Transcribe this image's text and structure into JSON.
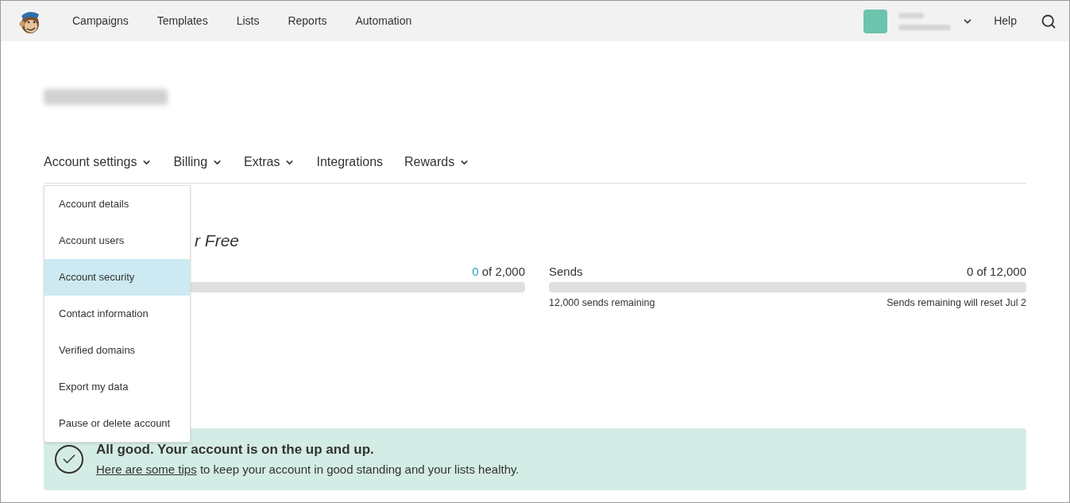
{
  "nav": {
    "items": [
      "Campaigns",
      "Templates",
      "Lists",
      "Reports",
      "Automation"
    ],
    "help": "Help"
  },
  "subnav": [
    {
      "label": "Account settings",
      "has_menu": true
    },
    {
      "label": "Billing",
      "has_menu": true
    },
    {
      "label": "Extras",
      "has_menu": true
    },
    {
      "label": "Integrations",
      "has_menu": false
    },
    {
      "label": "Rewards",
      "has_menu": true
    }
  ],
  "menu": [
    {
      "label": "Account details",
      "selected": false
    },
    {
      "label": "Account users",
      "selected": false
    },
    {
      "label": "Account security",
      "selected": true
    },
    {
      "label": "Contact information",
      "selected": false
    },
    {
      "label": "Verified domains",
      "selected": false
    },
    {
      "label": "Export my data",
      "selected": false
    },
    {
      "label": "Pause or delete account",
      "selected": false
    }
  ],
  "plan": {
    "title": "r Free"
  },
  "contacts": {
    "used": "0",
    "total": "of 2,000",
    "level": 0
  },
  "sends": {
    "label": "Sends",
    "reading": "0 of 12,000",
    "level": 0,
    "remaining": "12,000 sends remaining",
    "reset": "Sends remaining will reset Jul 2"
  },
  "notice": {
    "title": "All good. Your account is on the up and up.",
    "link": "Here are some tips",
    "text": "to keep your account in good standing and your lists healthy."
  }
}
